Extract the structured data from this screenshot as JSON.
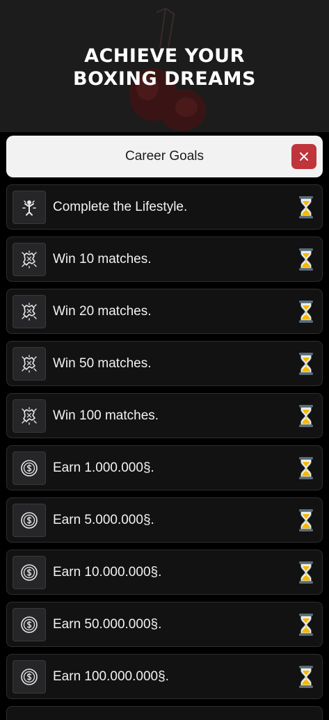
{
  "hero": {
    "title_line1": "ACHIEVE YOUR",
    "title_line2": "BOXING DREAMS",
    "art_icon": "boxing-gloves-icon"
  },
  "header": {
    "title": "Career Goals",
    "close_icon": "close-icon"
  },
  "colors": {
    "accent_close": "#c0343b",
    "hourglass_sand": "#f5b800",
    "hourglass_frame": "#5a6b78"
  },
  "goals": [
    {
      "label": "Complete the Lifestyle.",
      "icon": "lifestyle-icon",
      "status": "in-progress"
    },
    {
      "label": "Win 10 matches.",
      "icon": "fist-punch-icon",
      "status": "in-progress"
    },
    {
      "label": "Win 20 matches.",
      "icon": "fist-punch-icon",
      "status": "in-progress"
    },
    {
      "label": "Win 50 matches.",
      "icon": "fist-punch-icon",
      "status": "in-progress"
    },
    {
      "label": "Win 100 matches.",
      "icon": "fist-punch-icon",
      "status": "in-progress"
    },
    {
      "label": "Earn 1.000.000§.",
      "icon": "coin-icon",
      "status": "in-progress"
    },
    {
      "label": "Earn 5.000.000§.",
      "icon": "coin-icon",
      "status": "in-progress"
    },
    {
      "label": "Earn 10.000.000§.",
      "icon": "coin-icon",
      "status": "in-progress"
    },
    {
      "label": "Earn 50.000.000§.",
      "icon": "coin-icon",
      "status": "in-progress"
    },
    {
      "label": "Earn 100.000.000§.",
      "icon": "coin-icon",
      "status": "in-progress"
    }
  ]
}
